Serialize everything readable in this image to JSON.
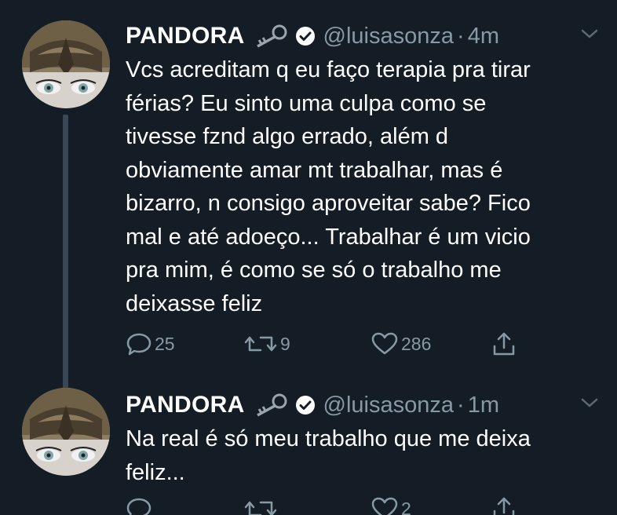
{
  "tweets": [
    {
      "display_name": "PANDORA",
      "handle": "@luisasonza",
      "separator": "·",
      "time": "4m",
      "text_lines": [
        "Vcs acreditam q eu faço terapia pra tirar",
        "férias? Eu sinto uma culpa como se",
        "tivesse fznd algo errado, além d",
        "obviamente amar mt trabalhar, mas é",
        "bizarro, n consigo aproveitar sabe? Fico",
        "mal e até adoeço... Trabalhar é um vicio",
        "pra mim, é como se só o trabalho me",
        "deixasse feliz"
      ],
      "replies": "25",
      "retweets": "9",
      "likes": "286"
    },
    {
      "display_name": "PANDORA",
      "handle": "@luisasonza",
      "separator": "·",
      "time": "1m",
      "text_lines": [
        "Na real é só meu trabalho que me deixa",
        "feliz..."
      ],
      "replies": "",
      "retweets": "",
      "likes": "2"
    }
  ],
  "icons": {
    "badge": "key-icon",
    "verified": "verified-badge-icon",
    "menu": "chevron-down-icon",
    "reply": "reply-icon",
    "retweet": "retweet-icon",
    "like": "heart-icon",
    "share": "share-icon"
  },
  "colors": {
    "background": "#141d26",
    "text": "#ffffff",
    "secondary": "#8899a6",
    "thread_line": "#3a4756"
  }
}
